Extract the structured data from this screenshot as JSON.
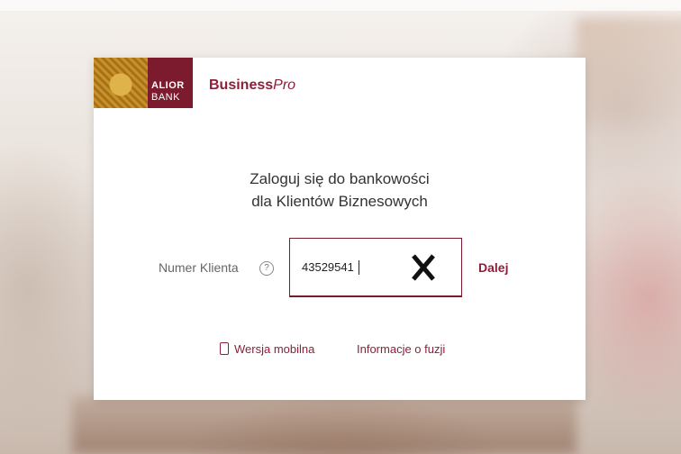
{
  "brand": {
    "logo_line1": "ALIOR",
    "logo_line2": "BANK",
    "product_bold": "Business",
    "product_italic": "Pro",
    "accent_color": "#8c1f3a"
  },
  "login": {
    "heading_line1": "Zaloguj się do bankowości",
    "heading_line2": "dla Klientów Biznesowych",
    "field_label": "Numer Klienta",
    "help_symbol": "?",
    "field_value": "43529541",
    "next_label": "Dalej"
  },
  "links": {
    "mobile_label": "Wersja mobilna",
    "fusion_label": "Informacje o fuzji"
  },
  "icons": {
    "clear": "close-icon",
    "help": "help-circle-icon",
    "phone": "mobile-phone-icon"
  }
}
